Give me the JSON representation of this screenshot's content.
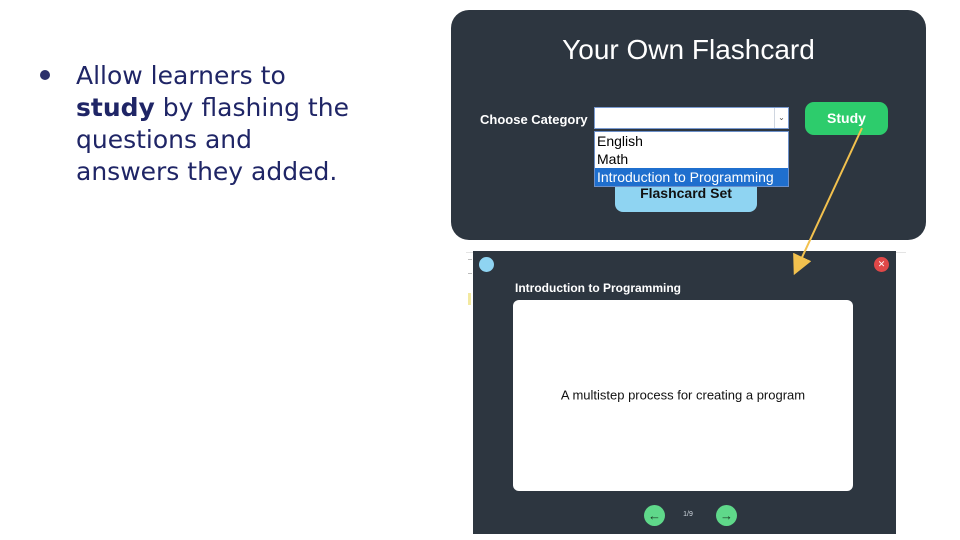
{
  "bullet": {
    "line1": "Allow learners to",
    "bold_word": "study",
    "line2_rest": " by flashing the",
    "line3": "questions and",
    "line4": "answers they added."
  },
  "top_panel": {
    "title": "Your Own Flashcard",
    "category_label": "Choose Category",
    "selected_value": "",
    "options": [
      "English",
      "Math",
      "Introduction to Programming"
    ],
    "highlighted_option_index": 2,
    "study_label": "Study",
    "set_button_label": "Flashcard Set"
  },
  "modal": {
    "title": "Introduction to Programming",
    "card_text": "A multistep process for creating a program",
    "counter": "1/9",
    "prev_icon": "arrow-left-icon",
    "next_icon": "arrow-right-icon",
    "close_icon": "close-icon"
  },
  "colors": {
    "panel_bg": "#2d3640",
    "study_green": "#2dcc6c",
    "light_blue": "#8fd4f2",
    "highlight_blue": "#1f6fce",
    "arrow_yellow": "#f2c14e",
    "close_red": "#e04848"
  }
}
